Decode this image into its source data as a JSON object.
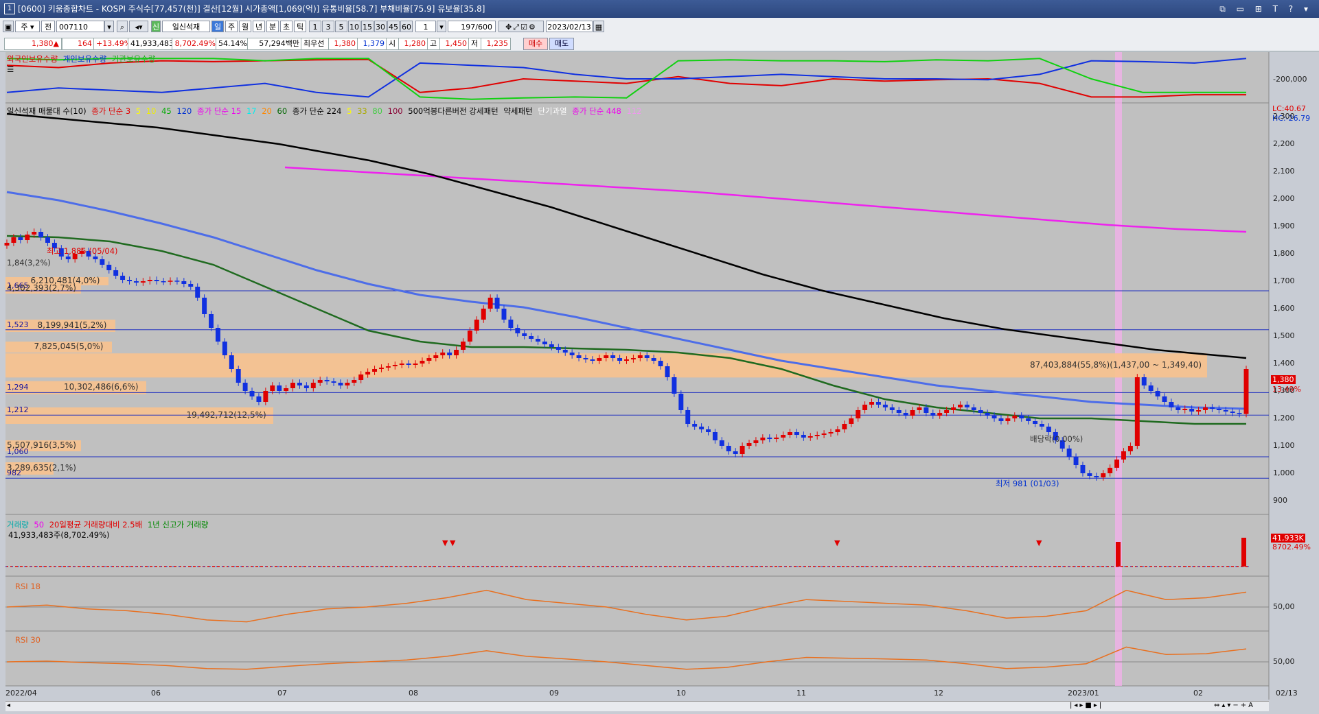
{
  "window": {
    "title": "[0600] 키움종합차트 - KOSPI 주식수[77,457(천)] 결산[12월] 시가총액[1,069(억)] 유통비율[58.7] 부채비율[75.9] 유보율[35.8]",
    "controls": "⧉ ▭ ⊞ T ? ▾"
  },
  "toolbar": {
    "period_main": "주",
    "market": "전",
    "code": "007110",
    "chart_type": "일신석재",
    "badge": "신",
    "periods": [
      "일",
      "주",
      "월",
      "년",
      "분",
      "초",
      "틱"
    ],
    "selected_period": "일",
    "minutes": [
      "1",
      "3",
      "5",
      "10",
      "15",
      "30",
      "45",
      "60"
    ],
    "interval": "1",
    "count": "197",
    "count_total": "/600",
    "date": "2023/02/13"
  },
  "quote": {
    "price": "1,380▲",
    "change": "164",
    "change_pct": "+13.49%",
    "volume": "41,933,483",
    "volume_pct": "8,702.49%",
    "turnover": "54.14%",
    "amount": "57,294백만",
    "pref_label": "최우선",
    "pref_price": "1,380",
    "pref_price2": "1,379",
    "open_label": "시",
    "open": "1,280",
    "high_label": "고",
    "high": "1,450",
    "low_label": "저",
    "low": "1,235",
    "buy": "매수",
    "sell": "매도"
  },
  "legends": {
    "holders": [
      "외국인보유수량",
      "개인보유수량",
      "기관보유수량"
    ],
    "price": "일신석재 매물대 수(10)",
    "ma1": "종가 단순 3",
    "ma1_rest": [
      "5",
      "10",
      "45",
      "120"
    ],
    "ma2": "종가 단순 15",
    "ma2_rest": [
      "17",
      "20",
      "60"
    ],
    "ma3": "종가 단순 224",
    "ma3_rest": [
      "5",
      "33",
      "80",
      "100"
    ],
    "pattern": "500억봉다른버전 강세패턴",
    "pattern2": "약세패턴",
    "pattern3": "단기과열",
    "ma4": "종가 단순 448",
    "ma4_rest": "112",
    "volume": "거래량",
    "volume_n": "50",
    "vol_avg": "20일평균 거래량대비 2.5배",
    "vol_high": "1년 신고가 거래량",
    "vol_value": "41,933,483주(8,702.49%)",
    "rsi18": "RSI 18",
    "rsi30": "RSI 30"
  },
  "annotations": {
    "high": "최고 1,885 (05/04)",
    "low": "최저 981 (01/03)",
    "dividend": "배당락(0.00%)",
    "lc": "LC:40.67",
    "hc": "HC:-26.79",
    "last_price": "1,380",
    "last_pct": "13.49%",
    "vol_last": "41,933K",
    "vol_last_pct": "8702.49%",
    "holder_axis": "-200,000",
    "rsi18_level": "50,00",
    "rsi30_level": "50,00",
    "first_box": "1,84(3,2%)"
  },
  "horizontal_levels": [
    "1,665",
    "1,523",
    "1,294",
    "1,212",
    "1,060",
    "982"
  ],
  "volume_profile": [
    {
      "label": "6,210,481(4,0%)",
      "low": 1690,
      "high": 1715
    },
    {
      "label": "4,302,393(2,7%)",
      "low": 1655,
      "high": 1690
    },
    {
      "label": "8,199,941(5,2%)",
      "low": 1515,
      "high": 1560
    },
    {
      "label": "7,825,045(5,0%)",
      "low": 1440,
      "high": 1480
    },
    {
      "label": "87,403,884(55,8%)(1,437,00 ~ 1,349,40)",
      "low": 1349,
      "high": 1437
    },
    {
      "label": "10,302,486(6,6%)",
      "low": 1288,
      "high": 1336
    },
    {
      "label": "19,492,712(12,5%)",
      "low": 1180,
      "high": 1240
    },
    {
      "label": "5,507,916(3,5%)",
      "low": 1080,
      "high": 1120
    },
    {
      "label": "3,289,635(2,1%)",
      "low": 995,
      "high": 1040
    }
  ],
  "chart_data": {
    "type": "candlestick",
    "title": "",
    "ylim": [
      850,
      2350
    ],
    "yticks": [
      "900",
      "1,000",
      "1,100",
      "1,200",
      "1,300",
      "1,400",
      "1,500",
      "1,600",
      "1,700",
      "1,800",
      "1,900",
      "2,000",
      "2,100",
      "2,200",
      "2,300"
    ],
    "xticks": [
      "2022/04",
      "06",
      "07",
      "08",
      "09",
      "10",
      "11",
      "12",
      "2023/01",
      "02",
      "02/13"
    ],
    "closes": [
      1840,
      1860,
      1850,
      1870,
      1880,
      1860,
      1840,
      1820,
      1790,
      1780,
      1800,
      1810,
      1790,
      1780,
      1760,
      1740,
      1720,
      1705,
      1700,
      1695,
      1700,
      1705,
      1700,
      1698,
      1702,
      1700,
      1690,
      1680,
      1640,
      1580,
      1530,
      1480,
      1430,
      1380,
      1330,
      1300,
      1280,
      1260,
      1300,
      1320,
      1300,
      1310,
      1330,
      1320,
      1310,
      1330,
      1340,
      1335,
      1330,
      1320,
      1330,
      1340,
      1360,
      1370,
      1380,
      1385,
      1390,
      1395,
      1400,
      1395,
      1400,
      1410,
      1420,
      1430,
      1440,
      1430,
      1450,
      1480,
      1520,
      1560,
      1600,
      1640,
      1600,
      1560,
      1530,
      1510,
      1500,
      1490,
      1480,
      1470,
      1460,
      1450,
      1440,
      1430,
      1420,
      1415,
      1410,
      1420,
      1430,
      1420,
      1410,
      1415,
      1420,
      1430,
      1420,
      1410,
      1390,
      1350,
      1290,
      1230,
      1180,
      1170,
      1160,
      1150,
      1120,
      1100,
      1080,
      1070,
      1100,
      1110,
      1120,
      1130,
      1125,
      1130,
      1140,
      1150,
      1140,
      1130,
      1135,
      1140,
      1145,
      1150,
      1160,
      1180,
      1200,
      1230,
      1250,
      1260,
      1250,
      1240,
      1230,
      1220,
      1210,
      1230,
      1240,
      1220,
      1210,
      1220,
      1230,
      1240,
      1250,
      1240,
      1230,
      1220,
      1210,
      1200,
      1190,
      1200,
      1210,
      1200,
      1190,
      1180,
      1170,
      1150,
      1120,
      1090,
      1060,
      1030,
      1000,
      990,
      985,
      1000,
      1020,
      1050,
      1080,
      1100,
      1350,
      1320,
      1300,
      1280,
      1260,
      1240,
      1230,
      1235,
      1225,
      1230,
      1240,
      1235,
      1230,
      1225,
      1220,
      1216,
      1380
    ],
    "ma224": [
      2310,
      2300,
      2290,
      2280,
      2270,
      2260,
      2245,
      2230,
      2215,
      2200,
      2180,
      2160,
      2140,
      2115,
      2090,
      2060,
      2030,
      2000,
      1970,
      1935,
      1900,
      1865,
      1830,
      1795,
      1760,
      1725,
      1695,
      1665,
      1640,
      1615,
      1590,
      1565,
      1545,
      1525,
      1510,
      1495,
      1480,
      1465,
      1450,
      1440,
      1430,
      1420
    ],
    "ma448": [
      2115,
      2100,
      2085,
      2070,
      2055,
      2040,
      2025,
      2005,
      1985,
      1965,
      1945,
      1925,
      1905,
      1890,
      1880
    ],
    "ma120": [
      2025,
      1995,
      1955,
      1910,
      1860,
      1800,
      1740,
      1690,
      1650,
      1625,
      1605,
      1570,
      1530,
      1490,
      1450,
      1410,
      1380,
      1350,
      1320,
      1300,
      1280,
      1260,
      1250,
      1240,
      1235
    ],
    "ma60": [
      1865,
      1860,
      1845,
      1810,
      1760,
      1680,
      1600,
      1520,
      1480,
      1460,
      1460,
      1455,
      1450,
      1440,
      1420,
      1380,
      1320,
      1270,
      1240,
      1220,
      1200,
      1200,
      1190,
      1180,
      1180
    ],
    "holders": {
      "foreign": [
        0.8,
        0.75,
        0.85,
        0.9,
        0.88,
        0.9,
        0.92,
        0.93,
        0.2,
        0.3,
        0.5,
        0.45,
        0.4,
        0.55,
        0.4,
        0.35,
        0.5,
        0.45,
        0.48,
        0.5,
        0.4,
        0.1,
        0.1,
        0.15,
        0.15
      ],
      "individual": [
        0.2,
        0.3,
        0.25,
        0.2,
        0.3,
        0.4,
        0.2,
        0.1,
        0.85,
        0.8,
        0.75,
        0.6,
        0.5,
        0.5,
        0.55,
        0.6,
        0.55,
        0.5,
        0.5,
        0.48,
        0.6,
        0.9,
        0.88,
        0.85,
        0.95
      ],
      "institution": [
        0.95,
        0.92,
        0.95,
        0.95,
        0.95,
        0.9,
        0.95,
        0.95,
        0.1,
        0.05,
        0.08,
        0.1,
        0.08,
        0.9,
        0.92,
        0.9,
        0.9,
        0.88,
        0.92,
        0.9,
        0.95,
        0.5,
        0.2,
        0.2,
        0.2
      ]
    },
    "rsi18": [
      0.5,
      0.55,
      0.45,
      0.4,
      0.3,
      0.15,
      0.1,
      0.3,
      0.45,
      0.5,
      0.6,
      0.75,
      0.95,
      0.7,
      0.6,
      0.5,
      0.3,
      0.15,
      0.25,
      0.5,
      0.7,
      0.65,
      0.6,
      0.55,
      0.4,
      0.2,
      0.25,
      0.4,
      0.95,
      0.7,
      0.75,
      0.9
    ],
    "rsi30": [
      0.5,
      0.52,
      0.48,
      0.45,
      0.4,
      0.32,
      0.3,
      0.38,
      0.45,
      0.5,
      0.55,
      0.65,
      0.8,
      0.65,
      0.58,
      0.5,
      0.4,
      0.3,
      0.35,
      0.5,
      0.62,
      0.6,
      0.58,
      0.55,
      0.45,
      0.32,
      0.36,
      0.45,
      0.9,
      0.7,
      0.72,
      0.85
    ]
  }
}
